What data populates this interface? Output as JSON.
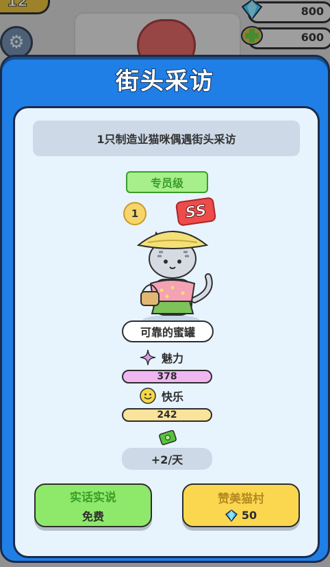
{
  "hud": {
    "level_badge": "12",
    "gems": "800",
    "tokens": "600"
  },
  "modal": {
    "title": "街头采访",
    "description": "1只制造业猫咪偶遇街头采访",
    "rank": "专员级",
    "level": "1",
    "grade": "SS",
    "cat_name": "可靠的蜜罐",
    "stats": {
      "charm_label": "魅力",
      "charm_value": "378",
      "happy_label": "快乐",
      "happy_value": "242"
    },
    "rate": "+2/天",
    "buttons": {
      "left_top": "实话实说",
      "left_bottom": "免费",
      "right_top": "赞美猫村",
      "right_cost": "50"
    }
  },
  "colors": {
    "modal_blue": "#1f7fe6",
    "inner_bg": "#e7f3fd",
    "green": "#8ee96a",
    "yellow": "#fbd74f",
    "charm": "#efb6f2",
    "happy": "#fae39a"
  },
  "icons": [
    "gear-icon",
    "gem-icon",
    "plus-icon",
    "charm-icon",
    "happy-face-icon",
    "cash-icon",
    "diamond-icon"
  ]
}
